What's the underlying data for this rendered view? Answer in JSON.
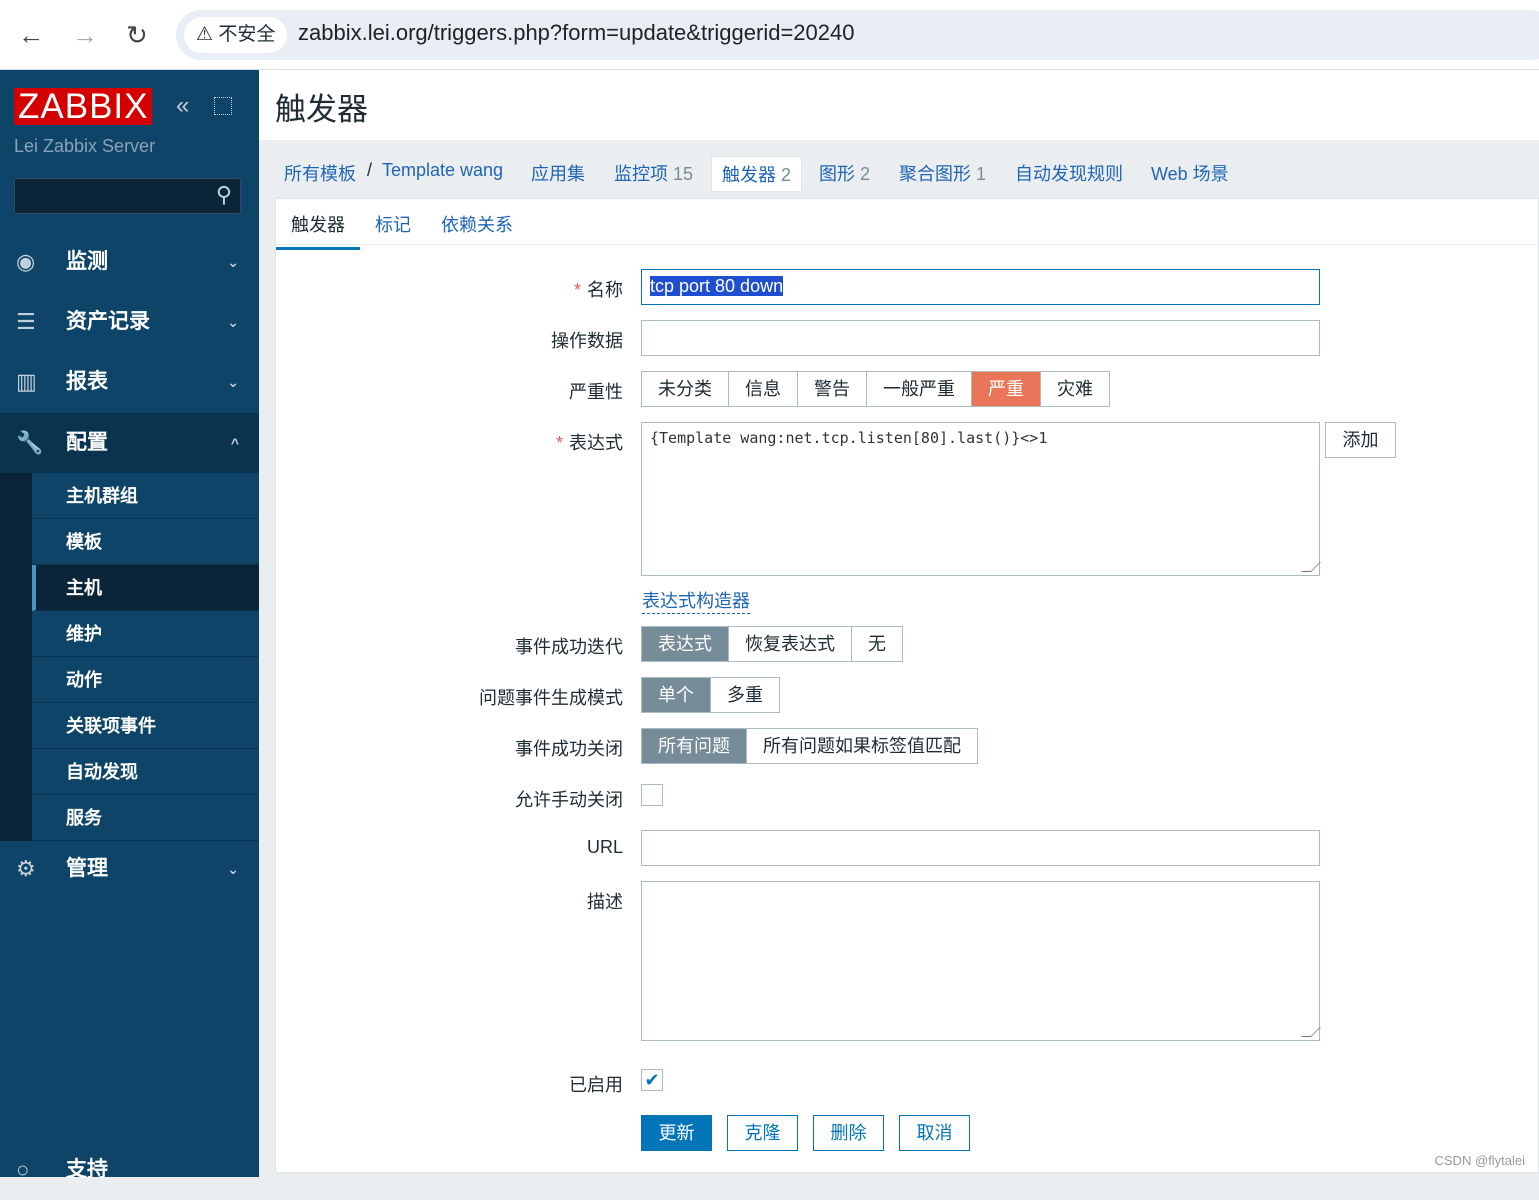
{
  "browser": {
    "security": "不安全",
    "url": "zabbix.lei.org/triggers.php?form=update&triggerid=20240"
  },
  "sidebar": {
    "logo": "ZABBIX",
    "server": "Lei Zabbix Server",
    "menu": [
      {
        "label": "监测",
        "icon": "eye-icon"
      },
      {
        "label": "资产记录",
        "icon": "list-icon"
      },
      {
        "label": "报表",
        "icon": "chart-icon"
      },
      {
        "label": "配置",
        "icon": "wrench-icon"
      },
      {
        "label": "管理",
        "icon": "gear-icon"
      },
      {
        "label": "支持",
        "icon": "help-icon"
      }
    ],
    "submenu": [
      "主机群组",
      "模板",
      "主机",
      "维护",
      "动作",
      "关联项事件",
      "自动发现",
      "服务"
    ]
  },
  "header": {
    "title": "触发器"
  },
  "breadcrumbs": {
    "all": "所有模板",
    "sep": "/",
    "template": "Template wang",
    "apps": "应用集",
    "items": "监控项",
    "items_count": "15",
    "triggers": "触发器",
    "triggers_count": "2",
    "graphs": "图形",
    "graphs_count": "2",
    "screens": "聚合图形",
    "screens_count": "1",
    "discovery": "自动发现规则",
    "web": "Web 场景"
  },
  "tabs": [
    "触发器",
    "标记",
    "依赖关系"
  ],
  "form": {
    "name_label": "名称",
    "name_value": "tcp port 80 down",
    "opdata_label": "操作数据",
    "opdata_value": "",
    "severity_label": "严重性",
    "severity": [
      "未分类",
      "信息",
      "警告",
      "一般严重",
      "严重",
      "灾难"
    ],
    "severity_selected": "严重",
    "expr_label": "表达式",
    "expr_value": "{Template wang:net.tcp.listen[80].last()}<>1",
    "add": "添加",
    "builder": "表达式构造器",
    "ok_event_label": "事件成功迭代",
    "ok_event": [
      "表达式",
      "恢复表达式",
      "无"
    ],
    "mode_label": "问题事件生成模式",
    "mode": [
      "单个",
      "多重"
    ],
    "close_label": "事件成功关闭",
    "close": [
      "所有问题",
      "所有问题如果标签值匹配"
    ],
    "manual_label": "允许手动关闭",
    "manual_close": false,
    "url_label": "URL",
    "url_value": "",
    "desc_label": "描述",
    "desc_value": "",
    "enabled_label": "已启用",
    "enabled": true,
    "buttons": {
      "update": "更新",
      "clone": "克隆",
      "delete": "删除",
      "cancel": "取消"
    }
  },
  "watermark": "CSDN @flytalei"
}
